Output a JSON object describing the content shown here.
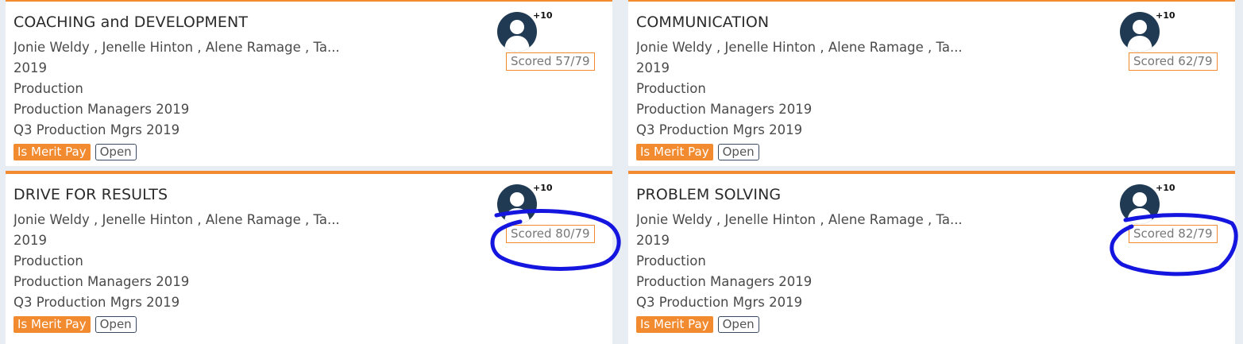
{
  "cards": [
    {
      "title": "COACHING and DEVELOPMENT",
      "participants": "Jonie Weldy , Jenelle Hinton , Alene Ramage , Ta...",
      "year": "2019",
      "department": "Production",
      "group": "Production Managers 2019",
      "period": "Q3 Production Mgrs 2019",
      "tag_merit": "Is Merit Pay",
      "tag_status": "Open",
      "more_count": "+10",
      "score": "Scored 57/79",
      "avatar_icon": "user-silhouette-icon"
    },
    {
      "title": "COMMUNICATION",
      "participants": "Jonie Weldy , Jenelle Hinton , Alene Ramage , Ta...",
      "year": "2019",
      "department": "Production",
      "group": "Production Managers 2019",
      "period": "Q3 Production Mgrs 2019",
      "tag_merit": "Is Merit Pay",
      "tag_status": "Open",
      "more_count": "+10",
      "score": "Scored 62/79",
      "avatar_icon": "user-silhouette-icon"
    },
    {
      "title": "DRIVE FOR RESULTS",
      "participants": "Jonie Weldy , Jenelle Hinton , Alene Ramage , Ta...",
      "year": "2019",
      "department": "Production",
      "group": "Production Managers 2019",
      "period": "Q3 Production Mgrs 2019",
      "tag_merit": "Is Merit Pay",
      "tag_status": "Open",
      "more_count": "+10",
      "score": "Scored 80/79",
      "avatar_icon": "user-silhouette-icon"
    },
    {
      "title": "PROBLEM SOLVING",
      "participants": "Jonie Weldy , Jenelle Hinton , Alene Ramage , Ta...",
      "year": "2019",
      "department": "Production",
      "group": "Production Managers 2019",
      "period": "Q3 Production Mgrs 2019",
      "tag_merit": "Is Merit Pay",
      "tag_status": "Open",
      "more_count": "+10",
      "score": "Scored 82/79",
      "avatar_icon": "user-silhouette-icon"
    }
  ],
  "colors": {
    "accent": "#f28a2f",
    "avatar": "#1f3a52",
    "annotation": "#1515e0",
    "background": "#e7edf3"
  }
}
